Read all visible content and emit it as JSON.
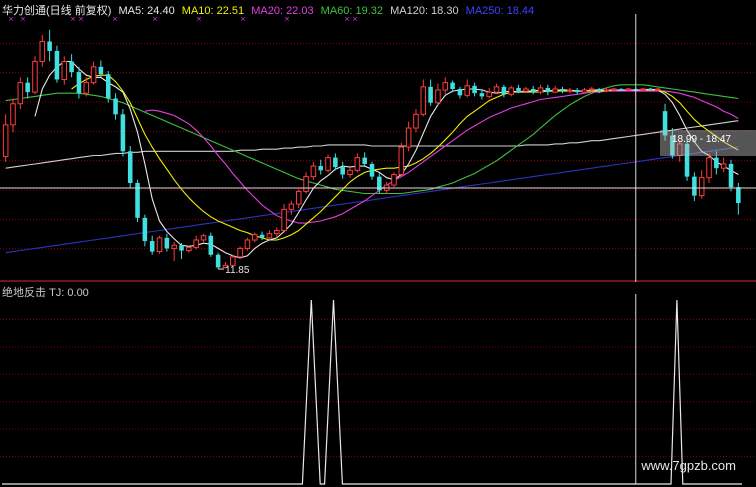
{
  "header": {
    "title": "华力创通(日线 前复权)",
    "ma": [
      {
        "label": "MA5: 24.40",
        "color": "#e8e8e8"
      },
      {
        "label": "MA10: 22.51",
        "color": "#f0f000"
      },
      {
        "label": "MA20: 22.03",
        "color": "#e040e0"
      },
      {
        "label": "MA60: 19.32",
        "color": "#40c040"
      },
      {
        "label": "MA120: 18.30",
        "color": "#d0d0d0"
      },
      {
        "label": "MA250: 18.44",
        "color": "#4040ff"
      }
    ]
  },
  "indicator": {
    "name": "绝地反击",
    "value_text": "TJ: 0.00"
  },
  "annotations": {
    "low_label": "11.85",
    "crosshair_label": "18.99 - 18.47"
  },
  "watermark": "www.7gpzb.com",
  "colors": {
    "up": "#ff3c3c",
    "down": "#40e0e0",
    "ma5": "#e8e8e8",
    "ma10": "#f0f000",
    "ma20": "#e040e0",
    "ma60": "#40c040",
    "ma120": "#d0d0d0",
    "ma250": "#3030c0",
    "grid": "#8b0000",
    "divider": "#b02020"
  },
  "chart_data": {
    "type": "candlestick",
    "title": "华力创通(日线 前复权)",
    "candles": [
      [
        22.5,
        25.5,
        26.5,
        22.0
      ],
      [
        25.5,
        27.5,
        28.0,
        24.8
      ],
      [
        27.5,
        29.5,
        30.0,
        27.0
      ],
      [
        29.5,
        28.6,
        30.0,
        28.0
      ],
      [
        28.6,
        31.5,
        32.0,
        28.4
      ],
      [
        31.5,
        33.4,
        34.0,
        31.0
      ],
      [
        33.4,
        32.5,
        34.5,
        31.5
      ],
      [
        32.5,
        29.8,
        33.0,
        29.5
      ],
      [
        29.8,
        31.5,
        32.0,
        29.3
      ],
      [
        31.5,
        30.5,
        32.2,
        30.0
      ],
      [
        30.5,
        28.5,
        31.0,
        28.0
      ],
      [
        28.5,
        29.5,
        30.0,
        28.2
      ],
      [
        29.5,
        31.0,
        31.5,
        29.3
      ],
      [
        31.0,
        30.3,
        31.6,
        30.0
      ],
      [
        30.3,
        28.0,
        30.6,
        27.6
      ],
      [
        28.0,
        26.5,
        28.5,
        26.0
      ],
      [
        26.5,
        23.0,
        27.0,
        22.5
      ],
      [
        23.0,
        20.0,
        23.5,
        19.5
      ],
      [
        20.0,
        16.7,
        20.3,
        16.3
      ],
      [
        16.7,
        14.5,
        17.0,
        14.0
      ],
      [
        14.5,
        13.5,
        15.0,
        13.2
      ],
      [
        13.5,
        14.8,
        15.0,
        13.3
      ],
      [
        14.8,
        13.8,
        15.2,
        13.5
      ],
      [
        13.8,
        14.1,
        14.4,
        12.6
      ],
      [
        14.1,
        13.6,
        14.3,
        12.8
      ],
      [
        13.6,
        13.9,
        14.0,
        13.4
      ],
      [
        13.9,
        14.6,
        15.0,
        13.7
      ],
      [
        14.6,
        15.0,
        15.2,
        14.4
      ],
      [
        15.0,
        13.2,
        15.3,
        13.0
      ],
      [
        13.2,
        12.0,
        13.4,
        11.85
      ],
      [
        12.0,
        12.2,
        12.5,
        11.9
      ],
      [
        12.2,
        13.0,
        13.2,
        12.1
      ],
      [
        13.0,
        13.8,
        14.0,
        12.9
      ],
      [
        13.8,
        14.6,
        14.8,
        13.6
      ],
      [
        14.6,
        15.1,
        15.3,
        14.4
      ],
      [
        15.1,
        14.8,
        15.4,
        14.6
      ],
      [
        14.8,
        15.2,
        15.5,
        14.7
      ],
      [
        15.2,
        15.5,
        15.8,
        14.9
      ],
      [
        15.5,
        17.5,
        18.0,
        15.4
      ],
      [
        17.5,
        18.0,
        18.3,
        17.0
      ],
      [
        18.0,
        19.2,
        19.4,
        17.6
      ],
      [
        19.2,
        20.6,
        21.0,
        19.0
      ],
      [
        20.6,
        21.6,
        22.0,
        20.3
      ],
      [
        21.6,
        21.2,
        22.2,
        20.8
      ],
      [
        21.2,
        22.4,
        22.7,
        21.0
      ],
      [
        22.4,
        21.5,
        22.8,
        21.2
      ],
      [
        21.5,
        20.8,
        22.0,
        20.4
      ],
      [
        20.8,
        21.2,
        21.5,
        20.5
      ],
      [
        21.2,
        22.4,
        22.8,
        21.0
      ],
      [
        22.4,
        21.8,
        22.9,
        21.5
      ],
      [
        21.8,
        20.6,
        22.0,
        20.3
      ],
      [
        20.6,
        19.3,
        20.9,
        19.0
      ],
      [
        19.3,
        19.8,
        20.1,
        19.0
      ],
      [
        19.8,
        20.8,
        21.0,
        19.6
      ],
      [
        20.8,
        23.4,
        23.8,
        20.6
      ],
      [
        23.4,
        25.2,
        25.8,
        23.0
      ],
      [
        25.2,
        26.5,
        27.0,
        24.8
      ],
      [
        26.5,
        29.1,
        29.8,
        26.3
      ],
      [
        29.1,
        27.6,
        29.8,
        27.3
      ],
      [
        27.6,
        28.8,
        29.4,
        27.4
      ],
      [
        28.8,
        29.5,
        30.0,
        28.4
      ],
      [
        29.5,
        28.9,
        29.7,
        28.6
      ],
      [
        28.9,
        28.3,
        29.1,
        28.0
      ],
      [
        28.3,
        29.2,
        29.8,
        28.1
      ],
      [
        29.2,
        28.5,
        29.5,
        28.2
      ],
      [
        28.5,
        28.2,
        28.9,
        27.9
      ],
      [
        28.2,
        28.6,
        29.0,
        28.0
      ],
      [
        28.6,
        29.1,
        29.4,
        28.4
      ],
      [
        29.1,
        28.4,
        29.3,
        28.1
      ],
      [
        28.4,
        29.0,
        29.2,
        28.2
      ],
      [
        29.0,
        28.7,
        29.3,
        28.5
      ],
      [
        28.7,
        28.9,
        29.1,
        28.5
      ],
      [
        28.9,
        28.6,
        29.2,
        28.4
      ],
      [
        28.6,
        29.0,
        29.3,
        28.4
      ],
      [
        29.0,
        28.6,
        29.3,
        28.3
      ],
      [
        28.6,
        28.9,
        29.2,
        28.5
      ],
      [
        28.9,
        28.7,
        29.1,
        28.5
      ],
      [
        28.7,
        28.8,
        29.0,
        28.5
      ],
      [
        28.8,
        28.6,
        29.0,
        28.4
      ],
      [
        28.6,
        28.8,
        29.0,
        28.5
      ],
      [
        28.8,
        28.9,
        29.1,
        28.6
      ],
      [
        28.9,
        28.7,
        29.0,
        28.5
      ],
      [
        28.7,
        28.8,
        29.0,
        28.6
      ],
      [
        28.8,
        28.9,
        29.0,
        28.7
      ],
      [
        28.9,
        28.8,
        29.0,
        28.7
      ],
      [
        28.8,
        28.9,
        29.0,
        28.7
      ],
      [
        28.9,
        28.8,
        29.0,
        28.7
      ],
      [
        28.8,
        28.9,
        29.0,
        28.7
      ],
      [
        28.9,
        28.8,
        29.0,
        28.7
      ],
      [
        28.8,
        28.9,
        29.0,
        28.7
      ],
      [
        26.8,
        24.5,
        27.5,
        24.0
      ],
      [
        24.5,
        22.6,
        25.2,
        22.3
      ],
      [
        22.6,
        23.7,
        24.0,
        22.0
      ],
      [
        23.7,
        20.6,
        24.2,
        20.2
      ],
      [
        20.6,
        18.8,
        21.0,
        18.3
      ],
      [
        18.8,
        20.5,
        21.2,
        18.5
      ],
      [
        20.5,
        22.4,
        22.8,
        20.0
      ],
      [
        22.4,
        21.4,
        23.0,
        20.8
      ],
      [
        21.4,
        21.8,
        22.4,
        21.0
      ],
      [
        21.8,
        19.6,
        22.2,
        19.2
      ],
      [
        19.6,
        18.1,
        20.0,
        17.0
      ]
    ],
    "ma5": [
      null,
      null,
      null,
      null,
      26.3,
      28.9,
      30.2,
      31.0,
      31.5,
      31.5,
      30.8,
      30.2,
      30.0,
      30.0,
      29.5,
      29.1,
      28.6,
      27.0,
      24.8,
      21.8,
      18.5,
      16.4,
      15.4,
      14.7,
      14.1,
      14.0,
      14.1,
      14.3,
      14.2,
      13.8,
      13.4,
      13.1,
      12.9,
      13.1,
      13.8,
      14.3,
      14.6,
      14.8,
      15.4,
      16.1,
      17.2,
      18.4,
      19.5,
      20.2,
      20.7,
      21.3,
      21.6,
      21.5,
      21.6,
      21.6,
      21.3,
      21.0,
      20.5,
      20.3,
      20.8,
      21.8,
      23.1,
      24.7,
      26.3,
      27.4,
      28.3,
      28.7,
      28.8,
      28.9,
      28.9,
      28.8,
      28.6,
      28.5,
      28.6,
      28.7,
      28.6,
      28.7,
      28.7,
      28.8,
      28.7,
      28.8,
      28.8,
      28.8,
      28.7,
      28.7,
      28.8,
      28.8,
      28.8,
      28.8,
      28.8,
      28.8,
      28.8,
      28.8,
      28.9,
      28.8,
      28.4,
      27.6,
      26.4,
      25.0,
      23.9,
      23.0,
      22.6,
      22.0,
      21.6,
      21.2,
      20.8
    ],
    "ma10": [
      null,
      null,
      null,
      null,
      null,
      null,
      null,
      null,
      null,
      28.9,
      29.4,
      29.8,
      30.1,
      30.2,
      30.2,
      29.6,
      28.7,
      27.6,
      26.1,
      24.6,
      23.4,
      22.3,
      21.3,
      20.3,
      19.4,
      18.6,
      17.9,
      17.3,
      16.8,
      16.4,
      16.1,
      15.8,
      15.5,
      15.3,
      15.0,
      14.8,
      14.6,
      14.6,
      14.8,
      15.1,
      15.5,
      16.1,
      16.7,
      17.3,
      18.0,
      18.7,
      19.4,
      20.1,
      20.6,
      21.0,
      21.2,
      21.3,
      21.4,
      21.4,
      21.5,
      21.6,
      21.9,
      22.3,
      22.8,
      23.4,
      24.1,
      24.8,
      25.6,
      26.3,
      26.8,
      27.3,
      27.8,
      28.1,
      28.4,
      28.6,
      28.6,
      28.6,
      28.6,
      28.6,
      28.7,
      28.7,
      28.7,
      28.7,
      28.7,
      28.7,
      28.7,
      28.7,
      28.7,
      28.8,
      28.8,
      28.8,
      28.8,
      28.8,
      28.8,
      28.8,
      28.6,
      28.2,
      27.6,
      26.8,
      26.0,
      25.4,
      24.9,
      24.4,
      23.9,
      23.5,
      23.1
    ],
    "ma20": [
      null,
      null,
      null,
      null,
      null,
      null,
      null,
      null,
      null,
      null,
      null,
      null,
      null,
      null,
      null,
      null,
      null,
      null,
      null,
      26.8,
      26.9,
      26.8,
      26.6,
      26.4,
      26.0,
      25.6,
      25.0,
      24.3,
      23.5,
      22.6,
      21.8,
      20.9,
      20.1,
      19.3,
      18.6,
      17.9,
      17.4,
      16.9,
      16.6,
      16.4,
      16.2,
      16.2,
      16.3,
      16.4,
      16.6,
      16.8,
      17.1,
      17.5,
      17.9,
      18.3,
      18.8,
      19.3,
      19.8,
      20.2,
      20.6,
      21.0,
      21.5,
      22.0,
      22.5,
      23.0,
      23.5,
      24.0,
      24.5,
      25.0,
      25.4,
      25.8,
      26.2,
      26.5,
      26.8,
      27.1,
      27.3,
      27.5,
      27.7,
      27.9,
      28.0,
      28.1,
      28.2,
      28.3,
      28.4,
      28.5,
      28.6,
      28.6,
      28.7,
      28.7,
      28.7,
      28.7,
      28.7,
      28.7,
      28.7,
      28.7,
      28.7,
      28.6,
      28.5,
      28.3,
      28.1,
      27.8,
      27.5,
      27.2,
      26.8,
      26.5,
      26.1
    ],
    "ma60": [
      27.8,
      27.9,
      28.0,
      28.1,
      28.2,
      28.3,
      28.4,
      28.5,
      28.5,
      28.5,
      28.5,
      28.4,
      28.3,
      28.2,
      28.0,
      27.8,
      27.6,
      27.3,
      27.0,
      26.7,
      26.4,
      26.1,
      25.8,
      25.5,
      25.2,
      24.9,
      24.6,
      24.3,
      24.0,
      23.7,
      23.4,
      23.1,
      22.8,
      22.5,
      22.2,
      21.9,
      21.6,
      21.3,
      21.0,
      20.7,
      20.4,
      20.2,
      20.0,
      19.8,
      19.6,
      19.4,
      19.3,
      19.2,
      19.1,
      19.0,
      19.0,
      19.0,
      19.0,
      19.0,
      19.0,
      19.1,
      19.2,
      19.3,
      19.4,
      19.6,
      19.8,
      20.0,
      20.3,
      20.6,
      20.9,
      21.3,
      21.7,
      22.1,
      22.6,
      23.1,
      23.6,
      24.1,
      24.6,
      25.2,
      25.8,
      26.4,
      26.9,
      27.4,
      27.8,
      28.2,
      28.5,
      28.8,
      29.0,
      29.2,
      29.3,
      29.3,
      29.3,
      29.3,
      29.2,
      29.1,
      29.0,
      28.9,
      28.8,
      28.7,
      28.6,
      28.5,
      28.4,
      28.3,
      28.2,
      28.1,
      28.0
    ],
    "ma120": [
      21.4,
      21.5,
      21.6,
      21.7,
      21.8,
      21.9,
      22.0,
      22.1,
      22.2,
      22.3,
      22.4,
      22.5,
      22.6,
      22.6,
      22.7,
      22.8,
      22.8,
      22.9,
      22.9,
      23.0,
      23.0,
      23.0,
      23.0,
      23.0,
      23.0,
      23.0,
      23.0,
      23.0,
      23.0,
      23.0,
      23.0,
      23.0,
      23.1,
      23.1,
      23.1,
      23.2,
      23.2,
      23.2,
      23.3,
      23.3,
      23.4,
      23.4,
      23.5,
      23.5,
      23.6,
      23.6,
      23.6,
      23.6,
      23.6,
      23.6,
      23.5,
      23.5,
      23.5,
      23.5,
      23.5,
      23.5,
      23.5,
      23.5,
      23.5,
      23.5,
      23.5,
      23.5,
      23.5,
      23.5,
      23.5,
      23.5,
      23.5,
      23.5,
      23.5,
      23.5,
      23.5,
      23.6,
      23.6,
      23.6,
      23.6,
      23.7,
      23.7,
      23.8,
      23.8,
      23.9,
      24.0,
      24.0,
      24.1,
      24.2,
      24.3,
      24.4,
      24.5,
      24.6,
      24.7,
      24.8,
      24.9,
      25.0,
      25.1,
      25.2,
      25.3,
      25.4,
      25.5,
      25.6,
      25.7,
      25.8,
      25.9
    ],
    "ma250": [
      13.4,
      13.5,
      13.6,
      13.7,
      13.8,
      13.9,
      14.0,
      14.1,
      14.2,
      14.3,
      14.4,
      14.5,
      14.6,
      14.7,
      14.8,
      14.9,
      15.0,
      15.1,
      15.2,
      15.3,
      15.4,
      15.5,
      15.6,
      15.7,
      15.8,
      15.9,
      16.0,
      16.1,
      16.2,
      16.3,
      16.4,
      16.5,
      16.6,
      16.7,
      16.8,
      16.9,
      17.0,
      17.1,
      17.2,
      17.3,
      17.4,
      17.5,
      17.6,
      17.7,
      17.8,
      17.9,
      18.0,
      18.1,
      18.2,
      18.3,
      18.4,
      18.5,
      18.6,
      18.7,
      18.8,
      18.9,
      19.0,
      19.1,
      19.2,
      19.3,
      19.4,
      19.5,
      19.6,
      19.7,
      19.8,
      19.9,
      20.0,
      20.1,
      20.2,
      20.3,
      20.4,
      20.5,
      20.6,
      20.7,
      20.8,
      20.9,
      21.0,
      21.1,
      21.2,
      21.3,
      21.4,
      21.5,
      21.6,
      21.7,
      21.8,
      21.9,
      22.0,
      22.1,
      22.2,
      22.3,
      22.4,
      22.5,
      22.6,
      22.7,
      22.8,
      22.9,
      23.0,
      23.1,
      23.2,
      23.3,
      23.4
    ],
    "ylim": [
      11.0,
      36.0
    ],
    "tj_series": [
      {
        "x": 0,
        "y": 0
      },
      {
        "x": 40.6,
        "y": 0
      },
      {
        "x": 41.8,
        "y": 1
      },
      {
        "x": 43.0,
        "y": 0
      },
      {
        "x": 43.6,
        "y": 0
      },
      {
        "x": 44.8,
        "y": 1
      },
      {
        "x": 46.0,
        "y": 0
      },
      {
        "x": 90.4,
        "y": 0
      },
      {
        "x": 91.2,
        "y": 1
      },
      {
        "x": 92.0,
        "y": 0
      },
      {
        "x": 100,
        "y": 0
      }
    ],
    "tj_ylim": [
      0,
      1
    ],
    "crosshair_index": 86
  }
}
